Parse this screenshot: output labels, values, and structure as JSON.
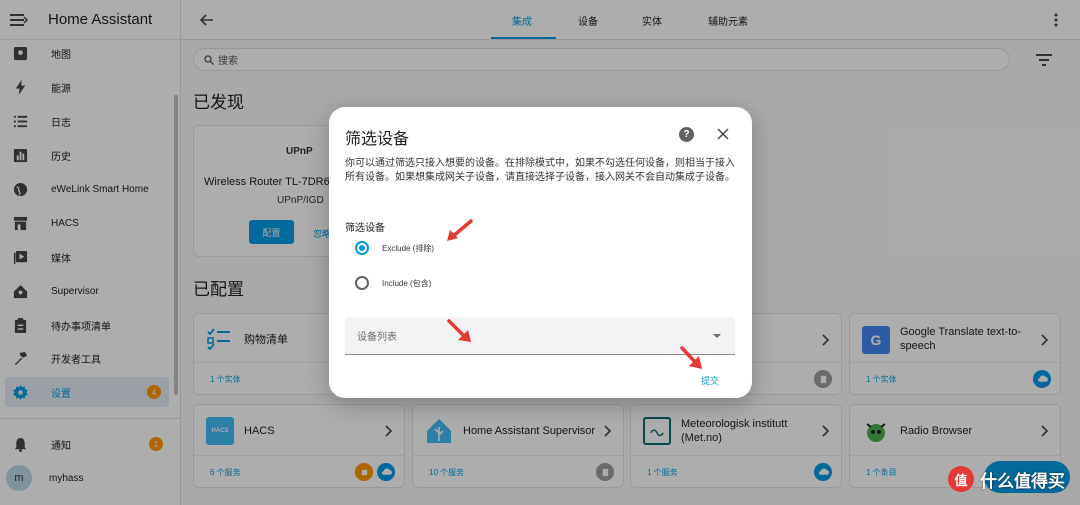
{
  "app": {
    "title": "Home Assistant"
  },
  "sidebar": {
    "items": [
      {
        "label": "地图",
        "icon": "map-icon"
      },
      {
        "label": "能源",
        "icon": "lightning-icon"
      },
      {
        "label": "日志",
        "icon": "list-icon"
      },
      {
        "label": "历史",
        "icon": "chart-bar-icon"
      },
      {
        "label": "eWeLink Smart Home",
        "icon": "globe-icon"
      },
      {
        "label": "HACS",
        "icon": "store-icon"
      },
      {
        "label": "媒体",
        "icon": "play-box-icon"
      },
      {
        "label": "Supervisor",
        "icon": "home-assistant-icon"
      },
      {
        "label": "待办事项清单",
        "icon": "clipboard-icon"
      },
      {
        "label": "开发者工具",
        "icon": "hammer-icon"
      },
      {
        "label": "设置",
        "icon": "gear-icon",
        "badge": "4"
      }
    ],
    "notifications": {
      "label": "通知",
      "badge": "1"
    },
    "user": {
      "initial": "m",
      "name": "myhass"
    }
  },
  "tabs": [
    {
      "label": "集成"
    },
    {
      "label": "设备"
    },
    {
      "label": "实体"
    },
    {
      "label": "辅助元素"
    }
  ],
  "search": {
    "placeholder": "搜索"
  },
  "discovered": {
    "title": "已发现",
    "card": {
      "logo": "UPnP",
      "name": "Wireless Router TL-7DR6",
      "type": "UPnP/IGD",
      "configure": "配置",
      "ignore": "忽略"
    }
  },
  "configured": {
    "title": "已配置",
    "cards": [
      {
        "title": "购物清单",
        "foot": "1 个实体"
      },
      {
        "title": "Google Translate text-to-speech",
        "foot": "1 个实体"
      },
      {
        "title": "HACS",
        "foot": "6 个服务"
      },
      {
        "title": "Home Assistant Supervisor",
        "foot": "10 个服务"
      },
      {
        "title": "Meteorologisk institutt (Met.no)",
        "foot": "1 个服务"
      },
      {
        "title": "Radio Browser",
        "foot": "1 个条目"
      }
    ]
  },
  "dialog": {
    "title": "筛选设备",
    "description": "你可以通过筛选只接入想要的设备。在排除模式中，如果不勾选任何设备，则相当于接入所有设备。如果想集成网关子设备，请直接选择子设备，接入网关不会自动集成子设备。",
    "field_label": "筛选设备",
    "options": [
      {
        "label": "Exclude (排除)",
        "checked": true
      },
      {
        "label": "Include (包含)",
        "checked": false
      }
    ],
    "select_placeholder": "设备列表",
    "submit": "提交"
  },
  "watermark": {
    "logo": "值",
    "text": "什么值得买"
  },
  "colors": {
    "accent": "#039be5",
    "badge": "#ff9800",
    "annotation": "#e53935"
  }
}
